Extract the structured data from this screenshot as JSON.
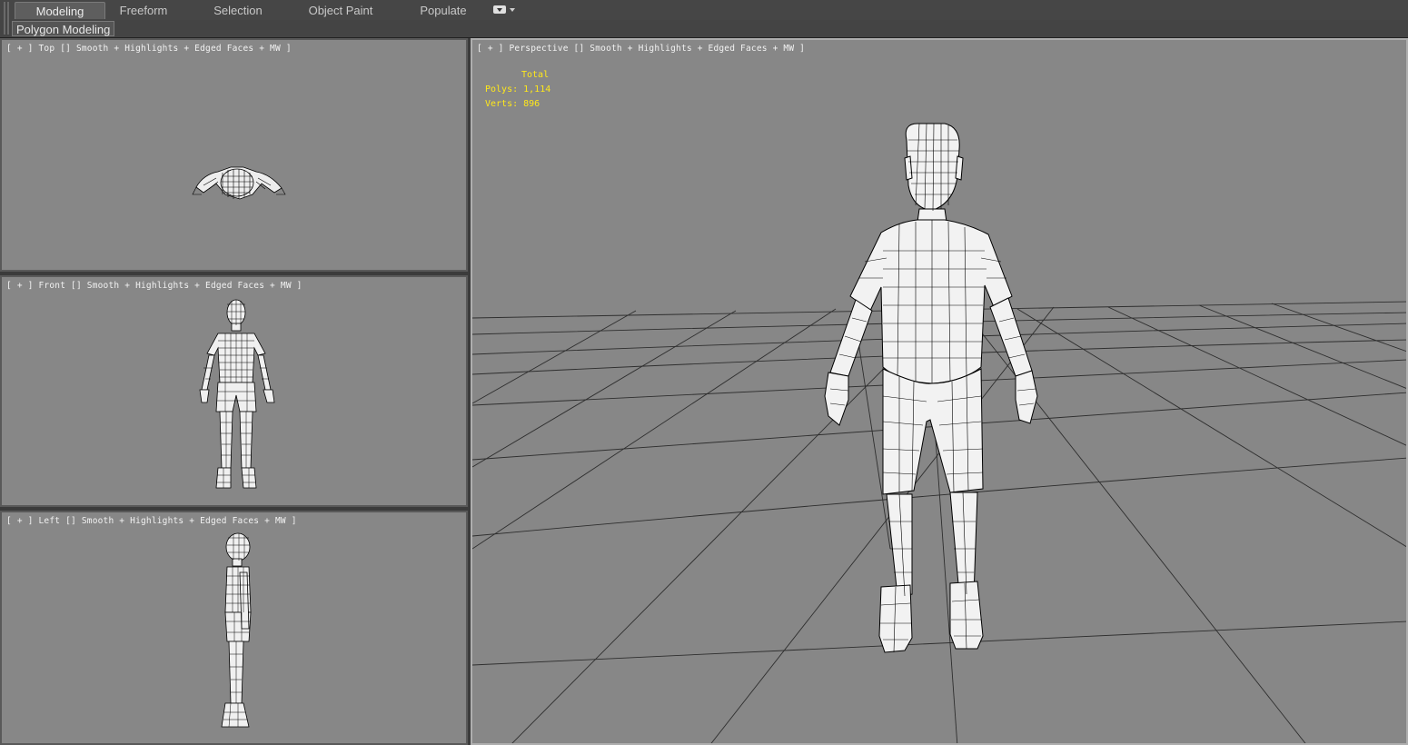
{
  "ribbon": {
    "tabs": [
      {
        "label": "Modeling",
        "active": true
      },
      {
        "label": "Freeform",
        "active": false
      },
      {
        "label": "Selection",
        "active": false
      },
      {
        "label": "Object Paint",
        "active": false
      },
      {
        "label": "Populate",
        "active": false
      }
    ],
    "dropdown_icon": "dropdown-toggle-icon",
    "panel_label": "Polygon Modeling"
  },
  "viewports": {
    "top": {
      "label": "[ + ] Top [] Smooth + Highlights + Edged Faces + MW ]"
    },
    "front": {
      "label": "[ + ] Front [] Smooth + Highlights + Edged Faces + MW ]"
    },
    "left": {
      "label": "[ + ] Left [] Smooth + Highlights + Edged Faces + MW ]"
    },
    "perspective": {
      "label": "[ + ] Perspective [] Smooth + Highlights + Edged Faces + MW ]",
      "stats": {
        "header": "Total",
        "polys": "Polys: 1,114",
        "verts": "Verts: 896"
      }
    }
  },
  "colors": {
    "viewport_bg": "#878787",
    "stats_text": "#ffe81a",
    "wire": "#000000",
    "mesh_fill": "#f2f2f2",
    "grid": "#2d2d2d"
  }
}
